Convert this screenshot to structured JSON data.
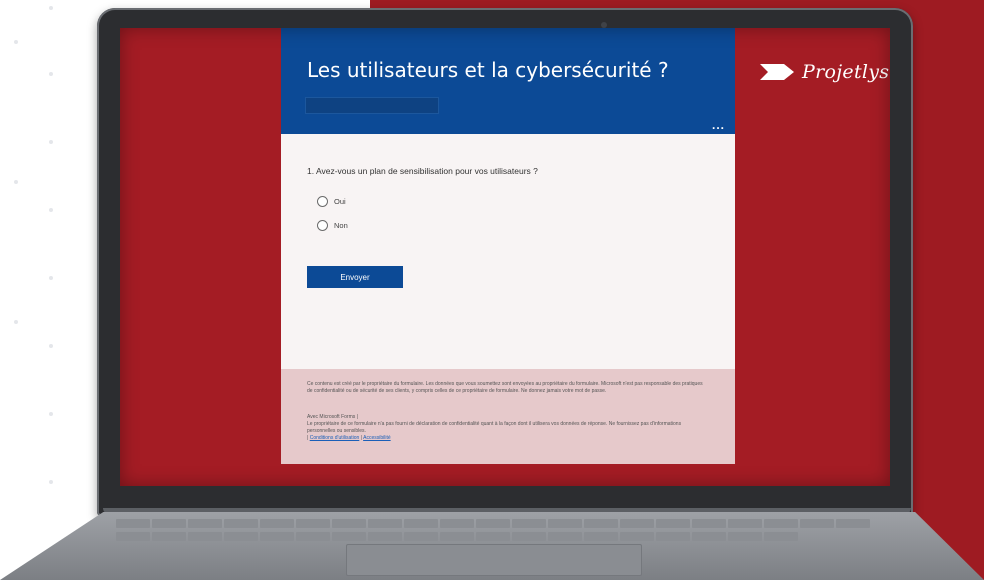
{
  "form": {
    "title": "Les utilisateurs et la cybersécurité ?",
    "more_menu": "...",
    "question": "1. Avez-vous un plan de sensibilisation pour vos utilisateurs ?",
    "options": [
      "Oui",
      "Non"
    ],
    "submit_label": "Envoyer",
    "footer": {
      "disclaimer": "Ce contenu est créé par le propriétaire du formulaire. Les données que vous soumettez sont envoyées au propriétaire du formulaire. Microsoft n'est pas responsable des pratiques de confidentialité ou de sécurité de ses clients, y compris celles de ce propriétaire de formulaire. Ne donnez jamais votre mot de passe.",
      "powered_by": "Avec Microsoft Forms |",
      "privacy_note": "Le propriétaire de ce formulaire n'a pas fourni de déclaration de confidentialité quant à la façon dont il utilisera vos données de réponse. Ne fournissez pas d'informations personnelles ou sensibles.",
      "link_prefix": "| ",
      "terms_link": "Conditions d'utilisation",
      "link_separator": " | ",
      "accessibility_link": "Accessibilité"
    }
  },
  "brand": {
    "name": "Projetlys"
  },
  "colors": {
    "red_background": "#9e1b22",
    "form_header_blue": "#0c4a96",
    "form_body": "#f8f4f4",
    "form_footer": "#e6c9cb"
  }
}
